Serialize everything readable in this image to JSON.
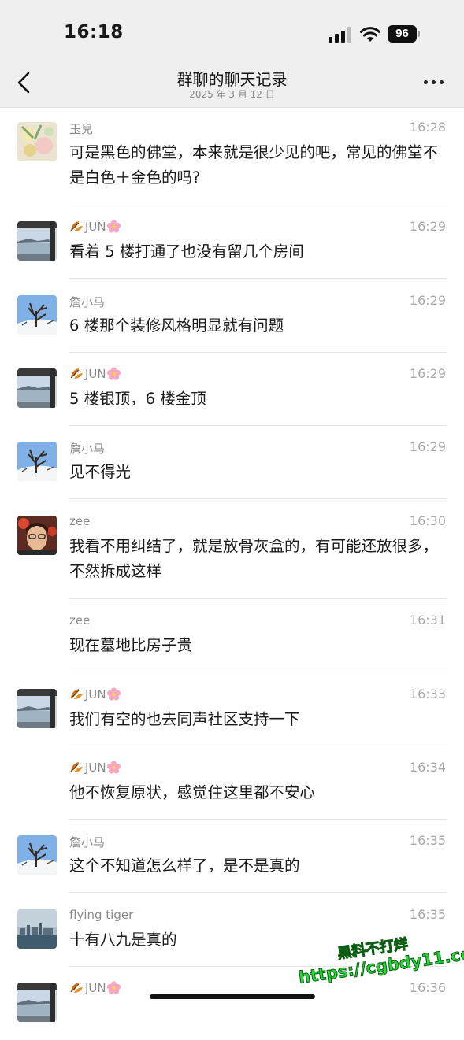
{
  "status_bar": {
    "time": "16:18",
    "battery": "96"
  },
  "header": {
    "title": "群聊的聊天记录",
    "subtitle": "2025 年 3 月 12 日"
  },
  "messages": [
    {
      "sender": "玉兒",
      "time": "16:28",
      "text": "可是黑色的佛堂，本来就是很少见的吧，常见的佛堂不是白色＋金色的吗?",
      "avatar": "flowers"
    },
    {
      "sender": "JUN",
      "time": "16:29",
      "text": "看着 5 楼打通了也没有留几个房间",
      "avatar": "lake-pavilion"
    },
    {
      "sender": "詹小马",
      "time": "16:29",
      "text": "6 楼那个装修风格明显就有问题",
      "avatar": "snow-tree"
    },
    {
      "sender": "JUN",
      "time": "16:29",
      "text": "5 楼银顶，6 楼金顶",
      "avatar": "lake-pavilion"
    },
    {
      "sender": "詹小马",
      "time": "16:29",
      "text": "见不得光",
      "avatar": "snow-tree"
    },
    {
      "sender": "zee",
      "time": "16:30",
      "text": "我看不用纠结了，就是放骨灰盒的，有可能还放很多，不然拆成这样",
      "avatar": "portrait"
    },
    {
      "sender": "zee",
      "time": "16:31",
      "text": "现在墓地比房子贵",
      "avatar": ""
    },
    {
      "sender": "JUN",
      "time": "16:33",
      "text": "我们有空的也去同声社区支持一下",
      "avatar": "lake-pavilion"
    },
    {
      "sender": "JUN",
      "time": "16:34",
      "text": "他不恢复原状，感觉住这里都不安心",
      "avatar": ""
    },
    {
      "sender": "詹小马",
      "time": "16:35",
      "text": "这个不知道怎么样了，是不是真的",
      "avatar": "snow-tree"
    },
    {
      "sender": "flying tiger",
      "time": "16:35",
      "text": "十有八九是真的",
      "avatar": "city-skyline"
    },
    {
      "sender": "JUN",
      "time": "16:36",
      "text": "",
      "avatar": "lake-pavilion"
    }
  ],
  "watermark": {
    "line1": "黑料不打烊",
    "line2": "https://cgbdy11.com"
  },
  "colors": {
    "header_bg": "#efefef",
    "divider": "#e6e6e6",
    "watermark": "#2bd63c"
  }
}
